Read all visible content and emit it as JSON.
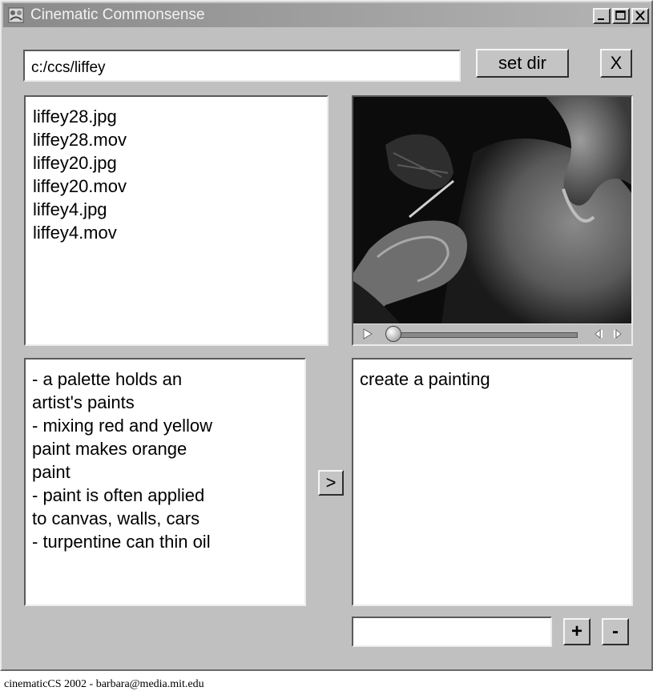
{
  "window": {
    "title": "Cinematic Commonsense",
    "controls": {
      "minimize": "_",
      "maximize": "□",
      "close": "X"
    }
  },
  "toolbar": {
    "path_value": "c:/ccs/liffey",
    "set_dir_label": "set dir",
    "close_label": "X"
  },
  "files": [
    "liffey28.jpg",
    "liffey28.mov",
    "liffey20.jpg",
    "liffey20.mov",
    "liffey4.jpg",
    "liffey4.mov"
  ],
  "knowledge_lines": [
    "- a palette holds an",
    "artist's paints",
    "- mixing red and yellow",
    "paint makes orange",
    "paint",
    "- paint is often applied",
    "to canvas, walls, cars",
    "- turpentine can thin oil"
  ],
  "transfer_label": ">",
  "annotations": [
    "create a painting"
  ],
  "annotation_input_value": "",
  "add_label": "+",
  "remove_label": "-",
  "player": {
    "progress": 0.0
  },
  "footer": "cinematicCS 2002 - barbara@media.mit.edu",
  "colors": {
    "window": "#c0c0c0",
    "titlebar": "#8a8a8a",
    "field": "#ffffff"
  },
  "icons": [
    "app-icon",
    "play-icon",
    "step-back-icon",
    "step-forward-icon"
  ]
}
